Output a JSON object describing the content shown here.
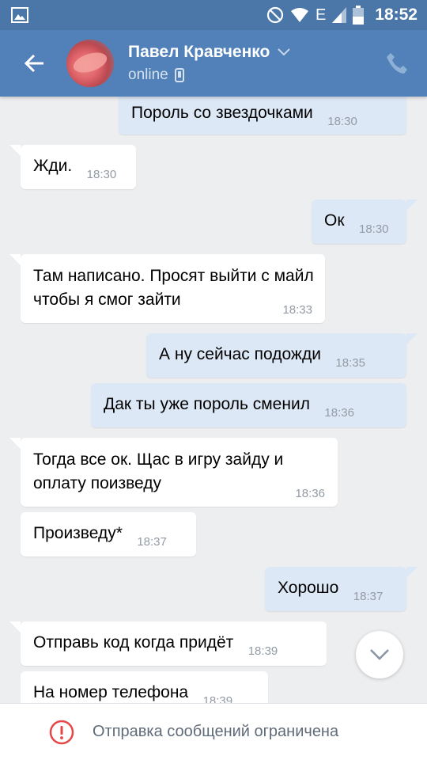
{
  "status_bar": {
    "time": "18:52",
    "network": "E",
    "icons": [
      "image-icon",
      "dnd-icon",
      "wifi-icon",
      "signal-icon",
      "battery-icon"
    ]
  },
  "header": {
    "contact_name": "Павел Кравченко",
    "status": "online",
    "icons": [
      "back-arrow-icon",
      "chevron-down-icon",
      "mobile-icon",
      "phone-icon"
    ]
  },
  "messages": [
    {
      "direction": "out",
      "text": "Пороль со звездочками",
      "time": "18:30"
    },
    {
      "direction": "in",
      "text": "Жди.",
      "time": "18:30"
    },
    {
      "direction": "out",
      "text": "Ок",
      "time": "18:30"
    },
    {
      "direction": "in",
      "text": "Там написано. Просят выйти с майл чтобы я смог зайти",
      "time": "18:33"
    },
    {
      "direction": "out",
      "text": "А ну сейчас подожди",
      "time": "18:35"
    },
    {
      "direction": "out",
      "text": "Дак ты уже пороль сменил",
      "time": "18:36"
    },
    {
      "direction": "in",
      "text": "Тогда все ок. Щас в игру зайду и оплату поизведу",
      "time": "18:36"
    },
    {
      "direction": "in",
      "text": "Произведу*",
      "time": "18:37"
    },
    {
      "direction": "out",
      "text": "Хорошо",
      "time": "18:37"
    },
    {
      "direction": "in",
      "text": "Отправь код когда придёт",
      "time": "18:39"
    },
    {
      "direction": "in",
      "text": "На номер телефона",
      "time": "18:39"
    }
  ],
  "bottom_bar": {
    "text": "Отправка сообщений ограничена",
    "icon": "warning-circle-icon"
  },
  "colors": {
    "header": "#5181b8",
    "status_bar": "#4a76a8",
    "chat_background": "#edeef0",
    "outgoing_bubble": "#dde8f6",
    "incoming_bubble": "#ffffff",
    "warning": "#e64646"
  }
}
